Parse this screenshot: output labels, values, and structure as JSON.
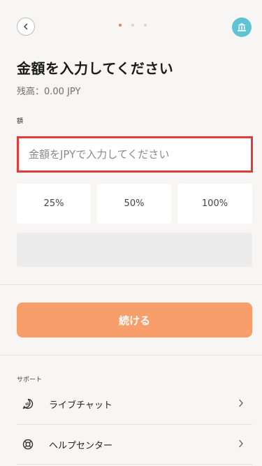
{
  "header": {
    "back_icon": "chevron-left-icon",
    "bank_icon": "bank-icon",
    "steps_total": 3,
    "steps_active": 1,
    "accent": "#f08040",
    "bank_color": "#5ec4d4"
  },
  "page": {
    "title": "金額を入力してください",
    "balance": "残高：0.00 JPY"
  },
  "form": {
    "amount_label": "額",
    "amount_placeholder": "金額をJPYで入力してください",
    "amount_value": "",
    "percent_options": [
      "25%",
      "50%",
      "100%"
    ],
    "continue_label": "続ける",
    "continue_color": "#f79e6b"
  },
  "support": {
    "section_label": "サポート",
    "items": [
      {
        "label": "ライブチャット",
        "icon": "chat-icon"
      },
      {
        "label": "ヘルプセンター",
        "icon": "lifebuoy-icon"
      }
    ]
  }
}
